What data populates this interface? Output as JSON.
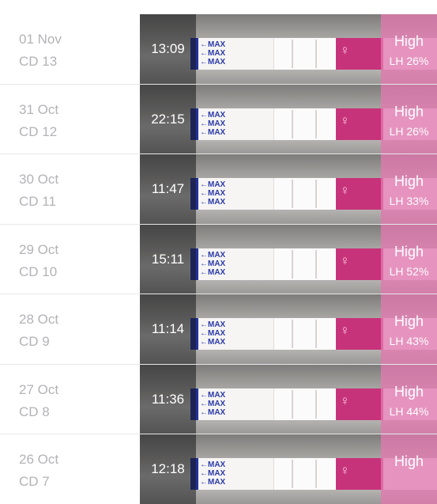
{
  "entries": [
    {
      "date": "01 Nov",
      "cycle_day": "CD 13",
      "time": "13:09",
      "level": "High",
      "lh": "LH 26%"
    },
    {
      "date": "31 Oct",
      "cycle_day": "CD 12",
      "time": "22:15",
      "level": "High",
      "lh": "LH 26%"
    },
    {
      "date": "30 Oct",
      "cycle_day": "CD 11",
      "time": "11:47",
      "level": "High",
      "lh": "LH 33%"
    },
    {
      "date": "29 Oct",
      "cycle_day": "CD 10",
      "time": "15:11",
      "level": "High",
      "lh": "LH 52%"
    },
    {
      "date": "28 Oct",
      "cycle_day": "CD 9",
      "time": "11:14",
      "level": "High",
      "lh": "LH 43%"
    },
    {
      "date": "27 Oct",
      "cycle_day": "CD 8",
      "time": "11:36",
      "level": "High",
      "lh": "LH 44%"
    },
    {
      "date": "26 Oct",
      "cycle_day": "CD 7",
      "time": "12:18",
      "level": "High",
      "lh": ""
    }
  ],
  "strip": {
    "max_text": "←MAX",
    "logo_text": "♀"
  },
  "colors": {
    "result_pink": "#e278af",
    "strip_magenta": "#c7337a",
    "max_blue": "#23329a"
  }
}
